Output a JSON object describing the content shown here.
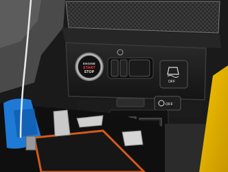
{
  "photo": {
    "start_button": {
      "line1": "ENGINE",
      "line2": "START",
      "line3": "STOP"
    },
    "traction_control_button": {
      "label": "OFF"
    },
    "auto_stop_start_button": {
      "label": "OFF"
    }
  }
}
